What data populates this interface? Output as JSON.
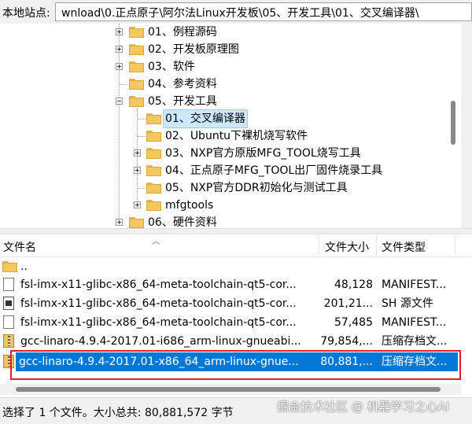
{
  "path_bar": {
    "label": "本地站点:",
    "path": "wnload\\0.正点原子\\阿尔法Linux开发板\\05、开发工具\\01、交叉编译器\\"
  },
  "tree": {
    "nodes": [
      {
        "label": "01、例程源码",
        "expander": "plus"
      },
      {
        "label": "02、开发板原理图",
        "expander": "plus"
      },
      {
        "label": "03、软件",
        "expander": "plus"
      },
      {
        "label": "04、参考资料",
        "expander": "none"
      },
      {
        "label": "05、开发工具",
        "expander": "minus"
      },
      {
        "label": "01、交叉编译器",
        "expander": "none",
        "selected": true
      },
      {
        "label": "02、Ubuntu下裸机烧写软件",
        "expander": "none"
      },
      {
        "label": "03、NXP官方原版MFG_TOOL烧写工具",
        "expander": "plus"
      },
      {
        "label": "04、正点原子MFG_TOOL出厂固件烧录工具",
        "expander": "plus"
      },
      {
        "label": "05、NXP官方DDR初始化与测试工具",
        "expander": "none"
      },
      {
        "label": "mfgtools",
        "expander": "plus"
      },
      {
        "label": "06、硬件资料",
        "expander": "plus"
      }
    ]
  },
  "file_list": {
    "columns": {
      "name": "文件名",
      "size": "文件大小",
      "type": "文件类型"
    },
    "rows": [
      {
        "icon": "folder-icon",
        "name": "..",
        "size": "",
        "type": ""
      },
      {
        "icon": "document-icon",
        "name": "fsl-imx-x11-glibc-x86_64-meta-toolchain-qt5-cor...",
        "size": "48,128",
        "type": "MANIFEST..."
      },
      {
        "icon": "shell-script-icon",
        "name": "fsl-imx-x11-glibc-x86_64-meta-toolchain-qt5-cor...",
        "size": "201,21...",
        "type": "SH 源文件"
      },
      {
        "icon": "document-icon",
        "name": "fsl-imx-x11-glibc-x86_64-meta-toolchain-qt5-cor...",
        "size": "57,485",
        "type": "MANIFEST..."
      },
      {
        "icon": "archive-icon",
        "name": "gcc-linaro-4.9.4-2017.01-i686_arm-linux-gnueabi...",
        "size": "79,854,...",
        "type": "压缩存档文..."
      },
      {
        "icon": "archive-icon",
        "name": "gcc-linaro-4.9.4-2017.01-x86_64_arm-linux-gnue...",
        "size": "80,881,...",
        "type": "压缩存档文...",
        "selected": true
      }
    ]
  },
  "status_bar": {
    "text": "选择了 1 个文件。大小总共: 80,881,572 字节"
  },
  "watermark": "掘金技术社区 @ 机器学习之心AI",
  "colors": {
    "selection": "#0078d7",
    "highlight_box": "#e02020",
    "folder": "#f5c85d",
    "tree_selection": "#cce8ff"
  }
}
